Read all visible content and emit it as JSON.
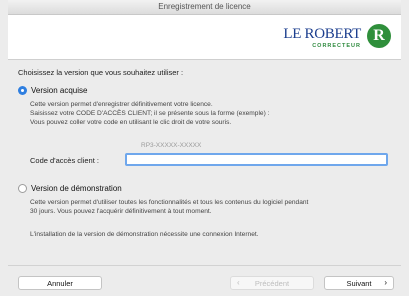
{
  "window": {
    "title": "Enregistrement de licence"
  },
  "logo": {
    "wordmark": "LE ROBERT",
    "subtitle": "CORRECTEUR",
    "badge_letter": "R"
  },
  "prompt": "Choisissez la version que vous souhaitez utiliser :",
  "option_acquired": {
    "label": "Version acquise",
    "selected": true,
    "lines": [
      "Cette version permet d'enregistrer définitivement votre licence.",
      "Saisissez votre CODE D'ACCÈS CLIENT; il se présente sous la forme (exemple) :",
      "Vous pouvez coller votre code en utilisant le clic droit de votre souris."
    ],
    "code_example": "RP3-XXXXX-XXXXX",
    "field_label": "Code d'accès client :",
    "field_value": ""
  },
  "option_demo": {
    "label": "Version de démonstration",
    "selected": false,
    "lines": [
      "Cette version permet d'utiliser toutes les fonctionnalités et tous les contenus du logiciel pendant",
      "30 jours. Vous pouvez l'acquérir définitivement à tout moment."
    ],
    "note": "L'installation de la version de démonstration nécessite une connexion Internet."
  },
  "footer": {
    "cancel": "Annuler",
    "previous": "Précédent",
    "next": "Suivant"
  }
}
